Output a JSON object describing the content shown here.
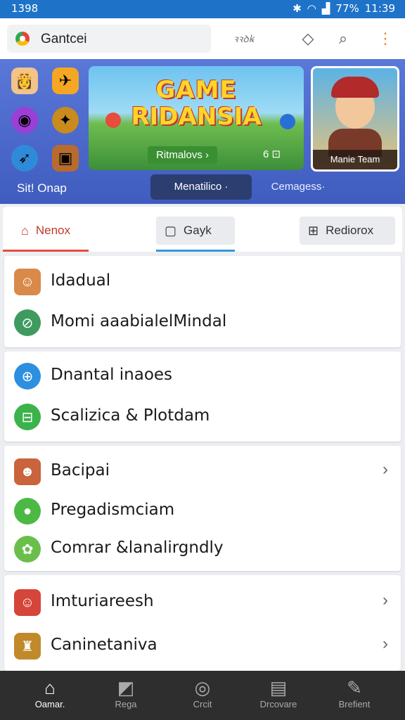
{
  "status_bar": {
    "time_left": "1398",
    "battery": "77%",
    "clock": "11:39",
    "bluetooth_icon": "bluetooth-icon",
    "wifi_icon": "wifi-icon",
    "signal_icon": "signal-icon"
  },
  "app_bar": {
    "search_text": "Gantcei",
    "hint": "ꝛꝛꝺꝃ",
    "tag_icon": "tag-icon",
    "search_icon": "search-icon",
    "more_icon": "more-vert-icon"
  },
  "hero": {
    "left_caption": "Sit! Onap",
    "banner": {
      "title_line1": "GAME",
      "title_line2": "RIDANSIA",
      "pill_label": "Ritmalovs ›",
      "tag_label": "6 ⊡"
    },
    "card_label": "Manie Team",
    "chip_primary": "Menatilico ·",
    "chip_secondary": "Cemagess·"
  },
  "tabs": [
    {
      "label": "Nenox",
      "icon": "home-icon",
      "active": true,
      "accent": "#e74c3c"
    },
    {
      "label": "Gayk",
      "icon": "tablet-icon",
      "active": false,
      "accent": "#3498db"
    },
    {
      "label": "Rediorox",
      "icon": "gift-icon",
      "active": false,
      "accent": "#888888"
    }
  ],
  "groups": [
    {
      "items": [
        {
          "label": "Idadual",
          "icon": "avatar-icon",
          "chevron": false
        },
        {
          "label": "Momi aaabialelMindal",
          "icon": "leaf-circle-icon",
          "chevron": false
        }
      ]
    },
    {
      "items": [
        {
          "label": "Dnantal inaoes",
          "icon": "globe-icon",
          "chevron": false
        },
        {
          "label": "Scalizica & Plotdam",
          "icon": "controller-icon",
          "chevron": false
        }
      ]
    },
    {
      "items": [
        {
          "label": "Bacipai",
          "icon": "character-icon",
          "chevron": true
        },
        {
          "label": "Pregadismciam",
          "icon": "green-orb-icon",
          "chevron": false
        },
        {
          "label": "Comrar &lanalirgndly",
          "icon": "grass-icon",
          "chevron": false
        }
      ]
    },
    {
      "items": [
        {
          "label": "Imturiareesh",
          "icon": "hero-icon",
          "chevron": true
        },
        {
          "label": "Caninetaniva",
          "icon": "warrior-icon",
          "chevron": true
        }
      ]
    }
  ],
  "bottom_nav": [
    {
      "label": "Oamar.",
      "icon": "home-icon",
      "active": true
    },
    {
      "label": "Rega",
      "icon": "card-stack-icon",
      "active": false
    },
    {
      "label": "Crcit",
      "icon": "gamepad-icon",
      "active": false
    },
    {
      "label": "Drcovare",
      "icon": "calendar-icon",
      "active": false
    },
    {
      "label": "Brefient",
      "icon": "edit-icon",
      "active": false
    }
  ]
}
